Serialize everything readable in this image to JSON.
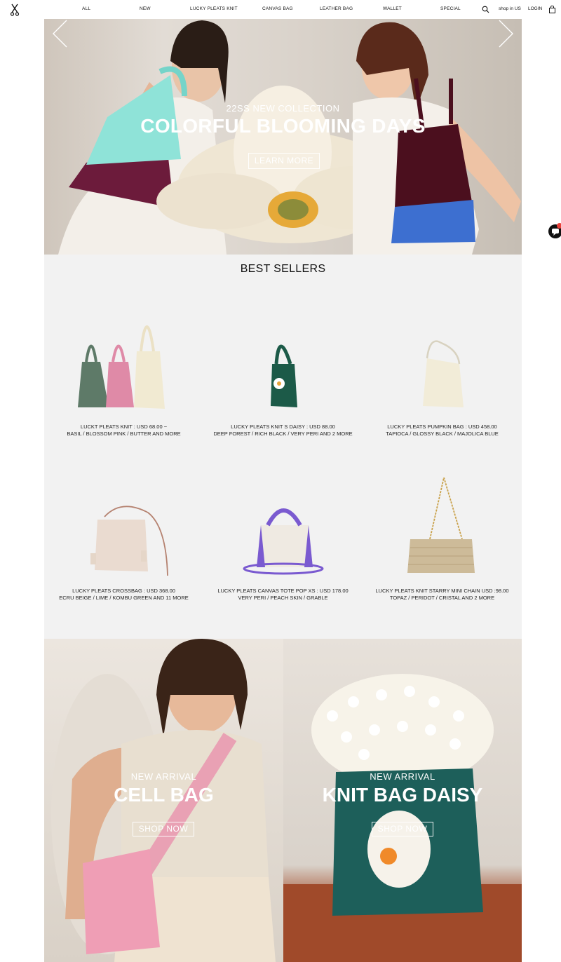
{
  "header": {
    "logo_icon": "scissors-logo-icon",
    "nav": [
      "ALL",
      "NEW",
      "LUCKY PLEATS KNIT",
      "CANVAS BAG",
      "LEATHER BAG",
      "WALLET",
      "SPECIAL"
    ],
    "search_icon": "search-icon",
    "region_label": "shop in US",
    "login_label": "LOGIN",
    "cart_icon": "shopping-bag-icon"
  },
  "hero": {
    "subtitle": "22SS NEW COLLECTION",
    "title": "COLORFUL BLOOMING DAYS",
    "button": "LEARN MORE",
    "prev_icon": "chevron-left-icon",
    "next_icon": "chevron-right-icon"
  },
  "chat": {
    "icon": "chat-bubble-icon",
    "badge_color": "#e9413a"
  },
  "best_sellers": {
    "title": "BEST SELLERS",
    "products": [
      {
        "name": "LUCKT PLEATS KNIT : USD 68.00 ~",
        "variants": "BASIL / BLOSSOM PINK / BUTTER AND MORE"
      },
      {
        "name": "LUCKY PLEATS KNIT S DAISY : USD 88.00",
        "variants": "DEEP FOREST / RICH BLACK / VERY PERI AND 2 MORE"
      },
      {
        "name": "LUCKY PLEATS PUMPKIN BAG : USD 458.00",
        "variants": "TAPIOCA / GLOSSY BLACK / MAJOLICA BLUE"
      },
      {
        "name": "LUCKY PLEATS CROSSBAG : USD 368.00",
        "variants": "ECRU BEIGE / LIME / KOMBU GREEN AND 11 MORE"
      },
      {
        "name": "LUCKY PLEATS CANVAS TOTE POP XS : USD 178.00",
        "variants": "VERY PERI / PEACH SKIN / GRABLE"
      },
      {
        "name": "LUCKY PLEATS KNIT STARRY MINI CHAIN  USD :98.00",
        "variants": "TOPAZ / PERIDOT / CRISTAL AND 2 MORE"
      }
    ]
  },
  "promos": [
    {
      "subtitle": "NEW ARRIVAL",
      "title": "CELL BAG",
      "button": "SHOP NOW"
    },
    {
      "subtitle": "NEW ARRIVAL",
      "title": "KNIT BAG DAISY",
      "button": "SHOP NOW"
    }
  ]
}
